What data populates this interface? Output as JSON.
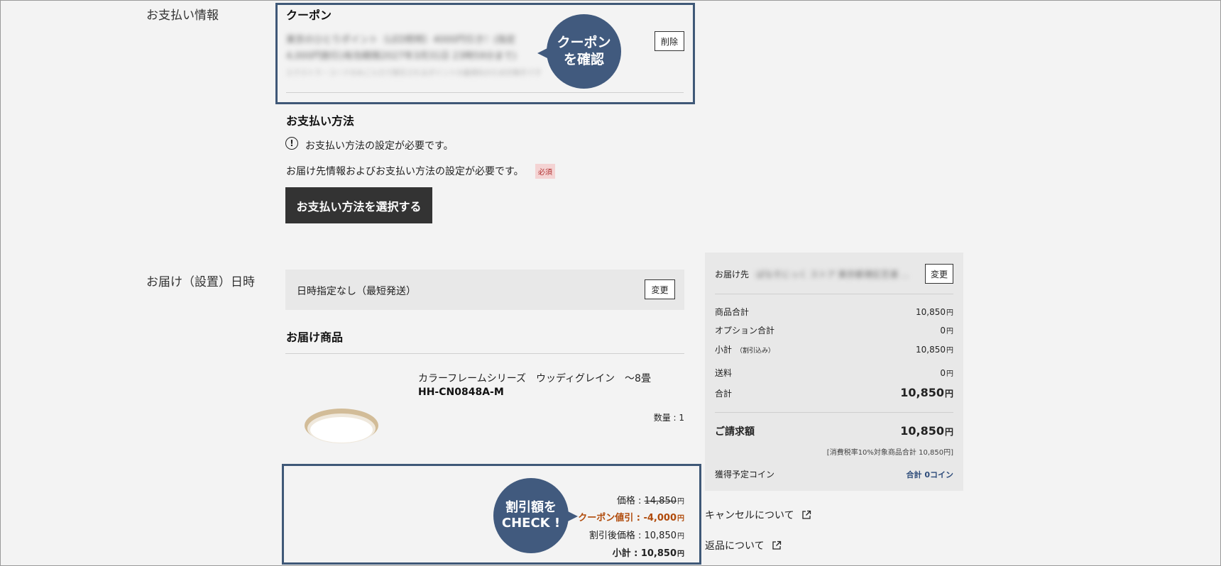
{
  "payment_section": {
    "label": "お支払い情報",
    "coupon": {
      "title": "クーポン",
      "blurred_line1": "東京のひとりポイント（LED照明）4000円引き！(指定",
      "blurred_line2": "4,000円割引)有効期限2027年3月31日 23時59分まで)",
      "blurred_line3": "エクストラ・コードのみご入力で割引されるポイントの最適化のため対象外です",
      "delete_label": "削除",
      "bubble_line1": "クーポン",
      "bubble_line2": "を確認"
    },
    "payment_method": {
      "title": "お支払い方法",
      "notice_icon": "exclamation-circle-icon",
      "notice": "お支払い方法の設定が必要です。",
      "requirement": "お届け先情報およびお支払い方法の設定が必要です。",
      "required_badge": "必須",
      "select_button": "お支払い方法を選択する"
    }
  },
  "delivery_section": {
    "label": "お届け（設置）日時",
    "datetime_value": "日時指定なし（最短発送）",
    "change_label": "変更",
    "products_title": "お届け商品",
    "product": {
      "name": "カラーフレームシリーズ　ウッディグレイン　～8畳",
      "model": "HH-CN0848A-M",
      "quantity": "数量 : 1",
      "price_label": "価格 : ",
      "price_value": "14,850",
      "coupon_label": "クーポン値引 : ",
      "coupon_value": "-4,000",
      "discounted_label": "割引後価格 : ",
      "discounted_value": "10,850",
      "subtotal_label": "小計 : ",
      "subtotal_value": "10,850",
      "yen": "円",
      "bubble_line1": "割引額を",
      "bubble_line2": "CHECK !"
    }
  },
  "summary": {
    "destination_label": "お届け先",
    "destination_blurred": "ぱなそにっく ストア 東京都港区芝浦 …",
    "change_label": "変更",
    "rows": [
      {
        "label": "商品合計",
        "value": "10,850"
      },
      {
        "label": "オプション合計",
        "value": "0"
      },
      {
        "label": "小計",
        "sub": "（割引込み）",
        "value": "10,850"
      },
      {
        "label": "送料",
        "value": "0"
      },
      {
        "label": "合計",
        "value": "10,850"
      }
    ],
    "yen": "円",
    "billing_label": "ご請求額",
    "billing_value": "10,850",
    "tax_note": "[消費税率10%対象商品合計 10,850円]",
    "coins_label": "獲得予定コイン",
    "coins_value": "合計  0コイン"
  },
  "links": {
    "cancel": "キャンセルについて",
    "returns": "返品について",
    "icon": "external-link-icon"
  },
  "colors": {
    "highlight": "#3f5877",
    "bubble": "#415a7e",
    "coupon_discount": "#b04a0a",
    "coin_blue": "#2d4b7a"
  }
}
